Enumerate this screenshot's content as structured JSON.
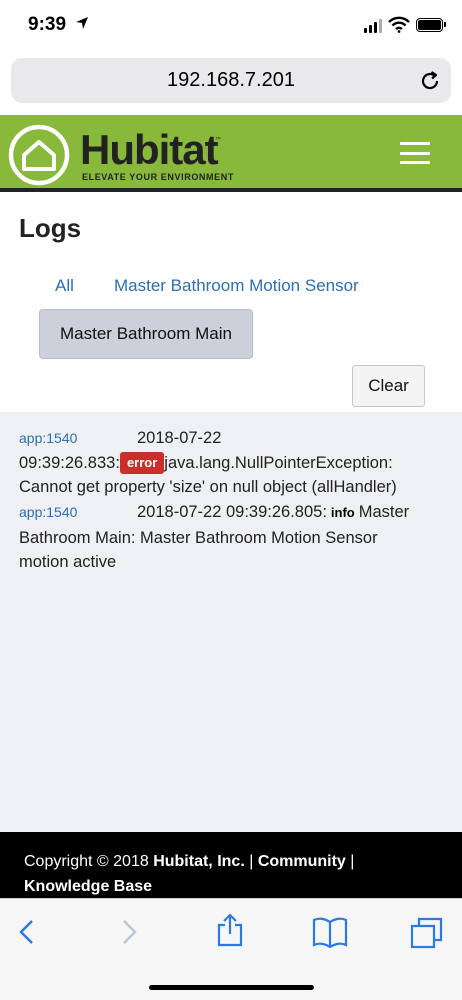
{
  "status_bar": {
    "time": "9:39"
  },
  "browser": {
    "url": "192.168.7.201"
  },
  "brand": {
    "name": "Hubitat",
    "tm": "™",
    "tagline": "ELEVATE YOUR ENVIRONMENT",
    "accent": "#88b93a"
  },
  "page": {
    "title": "Logs",
    "filters": {
      "all": "All",
      "device": "Master Bathroom Motion Sensor",
      "app": "Master Bathroom Main"
    },
    "clear_label": "Clear"
  },
  "logs": [
    {
      "source": "app:1540",
      "date": "2018-07-22",
      "time": "09:39:26.833:",
      "level": "error",
      "message": "java.lang.NullPointerException:",
      "message2": "Cannot get property 'size' on null object (allHandler)"
    },
    {
      "source": "app:1540",
      "timestamp": "2018-07-22 09:39:26.805:",
      "level": "info",
      "message": "Master",
      "message2": "Bathroom Main: Master Bathroom Motion Sensor",
      "message3": "motion active"
    }
  ],
  "footer": {
    "copyright": "Copyright © 2018 ",
    "company": "Hubitat, Inc.",
    "sep1": " | ",
    "community": "Community",
    "sep2": " |",
    "kb": "Knowledge Base"
  }
}
